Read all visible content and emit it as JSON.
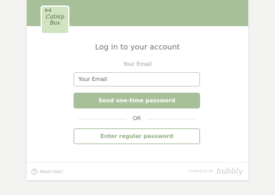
{
  "brand": {
    "logo_line1": "Catnip",
    "logo_line2": "Box",
    "header_color": "#a7c09a"
  },
  "login": {
    "title": "Log in to your account",
    "email_label": "Your Email",
    "email_placeholder": "Your Email",
    "email_value": "",
    "send_otp_label": "Send one-time password",
    "or_label": "OR",
    "regular_password_label": "Enter regular password"
  },
  "footer": {
    "need_help_label": "Need Help?",
    "help_icon": "help-circle-icon",
    "powered_by_label": "POWERED BY",
    "provider_name": "bubbly"
  }
}
